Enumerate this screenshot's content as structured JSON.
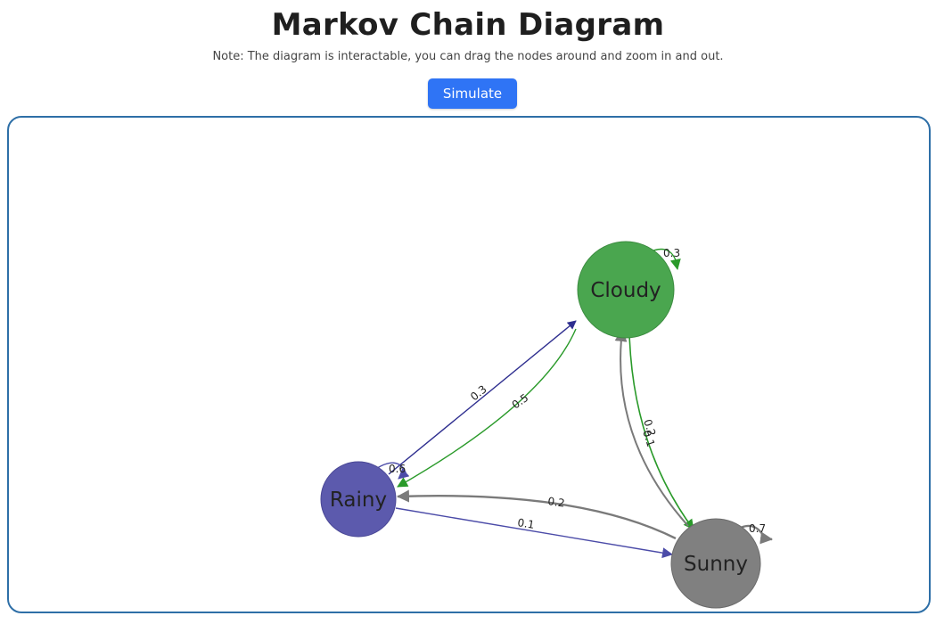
{
  "page": {
    "title": "Markov Chain Diagram",
    "note": "Note: The diagram is interactable, you can drag the nodes around and zoom in and out.",
    "simulate_label": "Simulate"
  },
  "diagram": {
    "nodes": [
      {
        "id": "cloudy",
        "label": "Cloudy",
        "color": "#4aa64f"
      },
      {
        "id": "rainy",
        "label": "Rainy",
        "color": "#5c5aad"
      },
      {
        "id": "sunny",
        "label": "Sunny",
        "color": "#808080"
      }
    ],
    "edges": [
      {
        "from": "rainy",
        "to": "cloudy",
        "prob": "0.3",
        "color": "#2e2e8f"
      },
      {
        "from": "cloudy",
        "to": "rainy",
        "prob": "0.5",
        "color": "#2a9a2a"
      },
      {
        "from": "cloudy",
        "to": "sunny",
        "prob": "0.2",
        "color": "#2a9a2a"
      },
      {
        "from": "sunny",
        "to": "cloudy",
        "prob": "0.1",
        "color": "#7a7a7a"
      },
      {
        "from": "sunny",
        "to": "rainy",
        "prob": "0.2",
        "color": "#7a7a7a"
      },
      {
        "from": "rainy",
        "to": "sunny",
        "prob": "0.1",
        "color": "#4b4ba8"
      },
      {
        "from": "cloudy",
        "to": "cloudy",
        "prob": "0.3",
        "color": "#2a9a2a"
      },
      {
        "from": "rainy",
        "to": "rainy",
        "prob": "0.6",
        "color": "#4b4ba8"
      },
      {
        "from": "sunny",
        "to": "sunny",
        "prob": "0.7",
        "color": "#7a7a7a"
      }
    ]
  }
}
